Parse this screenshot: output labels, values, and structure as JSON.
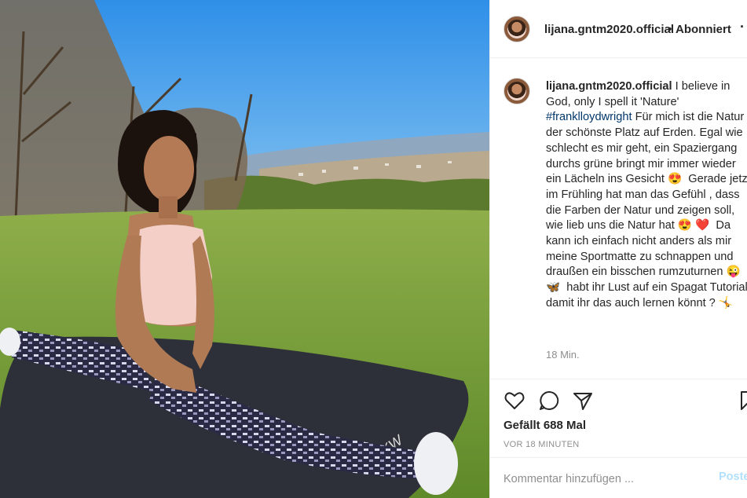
{
  "post": {
    "image_alt": "Woman doing a split on a yoga mat in a park",
    "author": "lijana.gntm2020.official",
    "header_separator": "•",
    "follow_status": "Abonniert",
    "more_icon": "more-icon",
    "caption": {
      "username": "lijana.gntm2020.official",
      "text_part1": " I believe in God, only I spell it 'Nature'\n",
      "hashtag": "#franklloydwright",
      "text_part2": " Für mich ist die Natur der schönste Platz auf Erden. Egal wie schlecht es mir geht, ein Spaziergang durchs grüne bringt mir immer wieder ein Lächeln ins Gesicht 😍  Gerade jetzt im Frühling hat man das Gefühl , dass die Farben der Natur und zeigen soll, wie lieb uns die Natur hat 😍 ❤️  Da kann ich einfach nicht anders als mir meine Sportmatte zu schnappen und draußen ein bisschen rumzuturnen 😜 🦋  habt ihr Lust auf ein Spagat Tutorial, damit ihr das auch lernen könnt ? 🤸"
    },
    "caption_time": "18 Min.",
    "likes": "Gefällt 688 Mal",
    "posted_ago": "VOR 18 MINUTEN",
    "comment_placeholder": "Kommentar hinzufügen ...",
    "post_button": "Posten"
  },
  "icons": {
    "like": "heart-icon",
    "comment": "comment-icon",
    "share": "paper-plane-icon",
    "save": "bookmark-icon"
  },
  "colors": {
    "text": "#262626",
    "secondary": "#8e8e8e",
    "hashtag": "#00376b",
    "post_button_disabled": "#b2dffc",
    "border": "#efefef"
  }
}
